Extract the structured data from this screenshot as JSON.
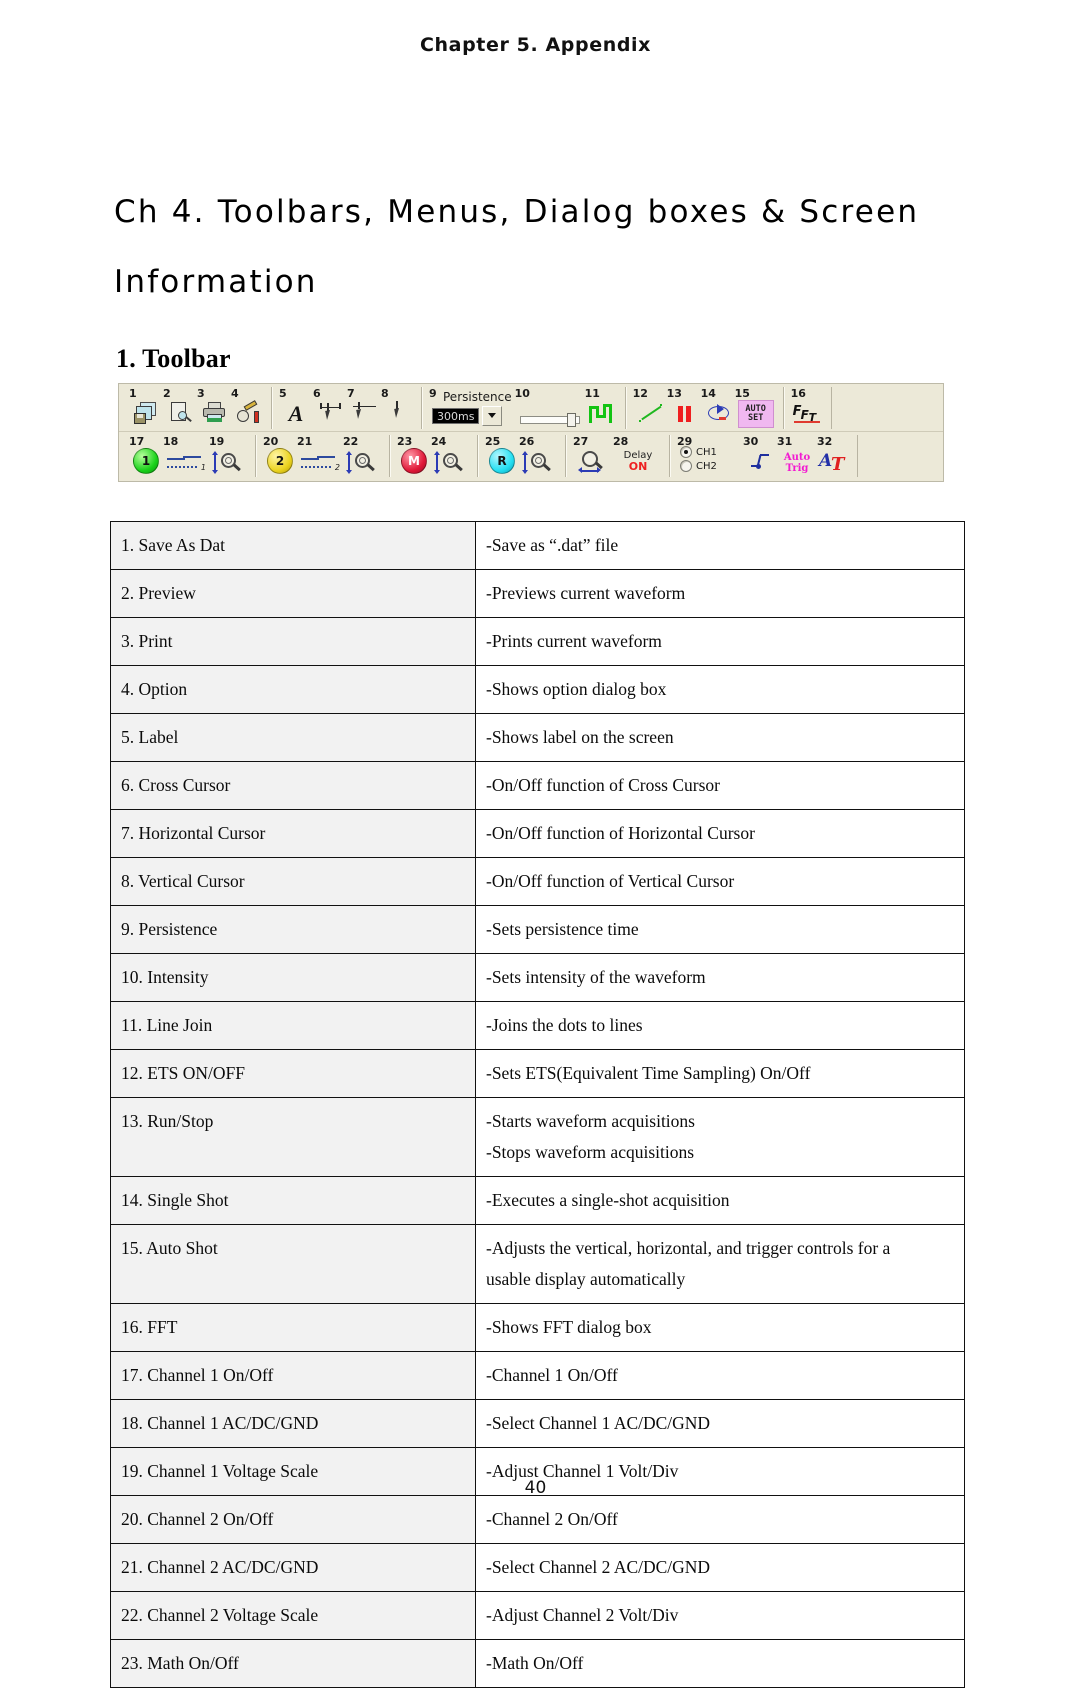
{
  "page": {
    "running_header": "Chapter 5. Appendix",
    "page_number": "40"
  },
  "chapter_title": {
    "line1": "Ch 4. Toolbars, Menus, Dialog boxes & Screen",
    "line2": "Information"
  },
  "section": {
    "heading": "1. Toolbar"
  },
  "toolbar_figure": {
    "persistence": {
      "label": "Persistence",
      "value": "300ms"
    },
    "autoset_line1": "AUTO",
    "autoset_line2": "SET",
    "fft_t1": "F",
    "fft_t2": "F",
    "fft_t3": "T",
    "delay_label": "Delay",
    "delay_state": "ON",
    "channel_select": {
      "ch1": "CH1",
      "ch2": "CH2"
    },
    "autotrig_line1": "Auto",
    "autotrig_line2": "Trig",
    "at_a": "A",
    "at_t": "T",
    "label_glyph": "A",
    "ball_ch1": "1",
    "ball_ch2": "2",
    "ball_math": "M",
    "ball_ref": "R",
    "acdc_ch1_sub": "1",
    "acdc_ch2_sub": "2",
    "numbers": {
      "n1": "1",
      "n2": "2",
      "n3": "3",
      "n4": "4",
      "n5": "5",
      "n6": "6",
      "n7": "7",
      "n8": "8",
      "n9": "9",
      "n10": "10",
      "n11": "11",
      "n12": "12",
      "n13": "13",
      "n14": "14",
      "n15": "15",
      "n16": "16",
      "n17": "17",
      "n18": "18",
      "n19": "19",
      "n20": "20",
      "n21": "21",
      "n22": "22",
      "n23": "23",
      "n24": "24",
      "n25": "25",
      "n26": "26",
      "n27": "27",
      "n28": "28",
      "n29": "29",
      "n30": "30",
      "n31": "31",
      "n32": "32"
    }
  },
  "table": {
    "rows": [
      {
        "name": "1. Save As Dat",
        "desc": "-Save as “.dat” file"
      },
      {
        "name": "2. Preview",
        "desc": "-Previews current waveform"
      },
      {
        "name": "3. Print",
        "desc": "-Prints current waveform"
      },
      {
        "name": "4. Option",
        "desc": "-Shows option dialog box"
      },
      {
        "name": "5. Label",
        "desc": "-Shows label on the screen"
      },
      {
        "name": "6. Cross Cursor",
        "desc": "-On/Off function of Cross Cursor"
      },
      {
        "name": "7. Horizontal Cursor",
        "desc": "-On/Off function of Horizontal Cursor"
      },
      {
        "name": "8. Vertical Cursor",
        "desc": "-On/Off function of Vertical Cursor"
      },
      {
        "name": "9. Persistence",
        "desc": "-Sets persistence time"
      },
      {
        "name": "10. Intensity",
        "desc": "-Sets intensity of the waveform"
      },
      {
        "name": "11. Line Join",
        "desc": "-Joins the dots to lines"
      },
      {
        "name": "12. ETS ON/OFF",
        "desc": "-Sets ETS(Equivalent Time Sampling) On/Off"
      },
      {
        "name": "13. Run/Stop",
        "desc": "-Starts waveform acquisitions",
        "desc2": "-Stops waveform acquisitions"
      },
      {
        "name": "14. Single Shot",
        "desc": "-Executes a single-shot acquisition"
      },
      {
        "name": "15. Auto Shot",
        "desc": "-Adjusts the vertical, horizontal, and trigger controls for a",
        "desc2": "usable display automatically",
        "justify": true
      },
      {
        "name": "16. FFT",
        "desc": "-Shows FFT dialog box"
      },
      {
        "name": "17. Channel 1 On/Off",
        "desc": "-Channel 1 On/Off"
      },
      {
        "name": "18. Channel 1 AC/DC/GND",
        "desc": "-Select Channel 1 AC/DC/GND"
      },
      {
        "name": "19. Channel 1 Voltage Scale",
        "desc": "-Adjust Channel 1 Volt/Div"
      },
      {
        "name": "20. Channel 2 On/Off",
        "desc": "-Channel 2 On/Off"
      },
      {
        "name": "21. Channel 2 AC/DC/GND",
        "desc": "-Select Channel 2 AC/DC/GND"
      },
      {
        "name": "22. Channel 2 Voltage Scale",
        "desc": "-Adjust Channel 2 Volt/Div"
      },
      {
        "name": "23. Math On/Off",
        "desc": "-Math On/Off"
      }
    ]
  }
}
